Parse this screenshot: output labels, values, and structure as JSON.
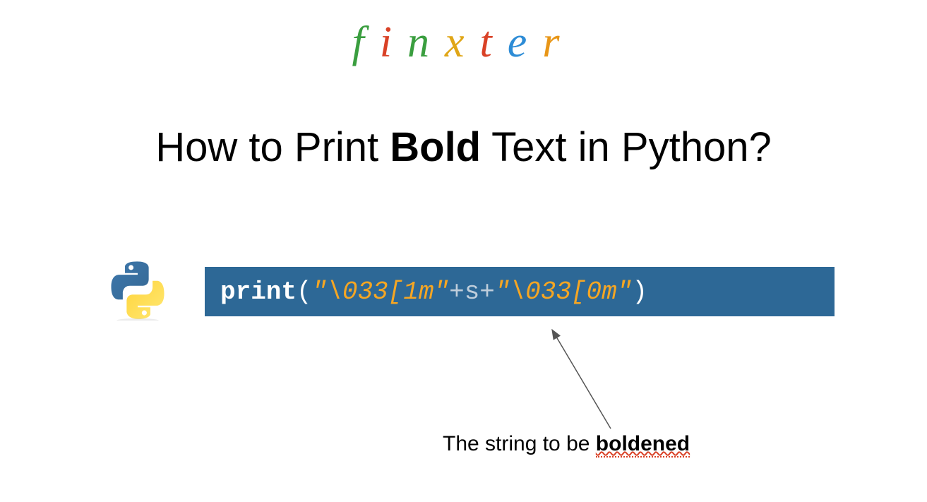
{
  "logo": {
    "letters": [
      "f",
      "i",
      "n",
      "x",
      "t",
      "e",
      "r"
    ]
  },
  "title": {
    "prefix": "How to Print ",
    "bold": "Bold",
    "suffix": " Text in Python?"
  },
  "code": {
    "keyword": "print",
    "open_paren": "(",
    "string1": "\"\\033[1m\"",
    "plus1": " + ",
    "variable": "s",
    "plus2": " + ",
    "string2": "\"\\033[0m\"",
    "close_paren": ")"
  },
  "annotation": {
    "prefix": "The string to be ",
    "bold": "boldened"
  }
}
